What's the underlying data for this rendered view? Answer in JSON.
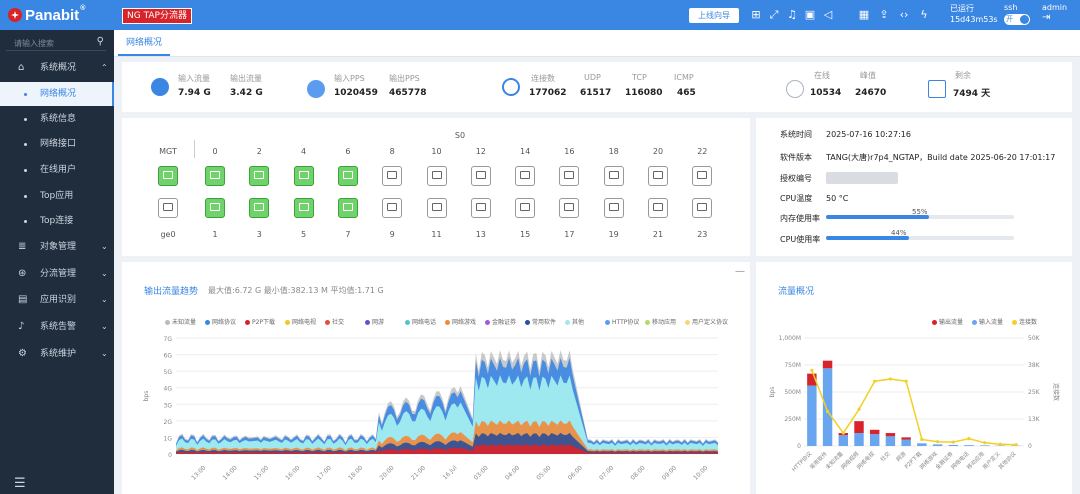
{
  "topbar": {
    "logo_text": "Panabit",
    "logo_reg": "®",
    "mode_badge": "NG TAP分流器",
    "guide_button": "上线向导",
    "uptime_label": "已运行",
    "uptime_value": "15d43m53s",
    "ssh_label": "ssh",
    "ssh_toggle": "开",
    "user_label": "admin",
    "brand_color": "#3a86e3",
    "badge_color": "#d8232a"
  },
  "sidebar": {
    "search_placeholder": "请输入搜索",
    "menu": [
      {
        "label": "系统概况",
        "icon": "home-icon"
      },
      {
        "label": "对象管理",
        "icon": "database-icon"
      },
      {
        "label": "分流管理",
        "icon": "flow-icon"
      },
      {
        "label": "应用识别",
        "icon": "app-icon"
      },
      {
        "label": "系统告警",
        "icon": "bell-icon"
      },
      {
        "label": "系统维护",
        "icon": "gear-icon"
      }
    ],
    "submenu": [
      {
        "label": "网络概况",
        "active": true
      },
      {
        "label": "系统信息"
      },
      {
        "label": "网络接口"
      },
      {
        "label": "在线用户"
      },
      {
        "label": "Top应用"
      },
      {
        "label": "Top连接"
      }
    ]
  },
  "tabs": [
    {
      "label": "网络概况"
    }
  ],
  "stats": {
    "in_traffic_label": "输入流量",
    "in_traffic": "7.94 G",
    "out_traffic_label": "输出流量",
    "out_traffic": "3.42 G",
    "in_pps_label": "输入PPS",
    "in_pps": "1020459",
    "out_pps_label": "输出PPS",
    "out_pps": "465778",
    "flows_label": "连接数",
    "flows": "177062",
    "udp_label": "UDP",
    "udp": "61517",
    "tcp_label": "TCP",
    "tcp": "116080",
    "icmp_label": "ICMP",
    "icmp": "465",
    "online_label": "在线",
    "online": "10534",
    "peak_label": "峰值",
    "peak": "24670",
    "license_label": "剩余",
    "license": "7494 天"
  },
  "ports": {
    "group_label": "S0",
    "mgt_label": "MGT",
    "mgt_port": "ge0",
    "top_numbers": [
      "0",
      "2",
      "4",
      "6",
      "8",
      "10",
      "12",
      "14",
      "16",
      "18",
      "20",
      "22"
    ],
    "bottom_numbers": [
      "1",
      "3",
      "5",
      "7",
      "9",
      "11",
      "13",
      "15",
      "17",
      "19",
      "21",
      "23"
    ],
    "top_up": [
      true,
      true,
      true,
      true,
      false,
      false,
      false,
      false,
      false,
      false,
      false,
      false
    ],
    "bottom_up": [
      true,
      true,
      true,
      true,
      false,
      false,
      false,
      false,
      false,
      false,
      false,
      false
    ],
    "mgt_top_up": true,
    "mgt_bottom_up": false
  },
  "sysinfo": {
    "time_label": "系统时间",
    "time_value": "2025-07-16 10:27:16",
    "version_label": "软件版本",
    "version_value": "TANG(大唐)r7p4_NGTAP，Build date 2025-06-20 17:01:17",
    "license_label": "授权编号",
    "cpu_temp_label": "CPU温度",
    "cpu_temp_value": "50 °C",
    "mem_label": "内存使用率",
    "mem_pct": 55,
    "mem_pct_text": "55%",
    "cpu_label": "CPU使用率",
    "cpu_pct": 44,
    "cpu_pct_text": "44%"
  },
  "trend": {
    "title": "输出流量趋势",
    "summary": "最大值:6.72 G  最小值:382.13 M  平均值:1.71 G",
    "legend": [
      "未知流量",
      "网络协议",
      "P2P下载",
      "网络电视",
      "社交",
      "网游",
      "网络电话",
      "网络游戏",
      "金融证券",
      "常用软件",
      "其他",
      "HTTP协议",
      "移动应用",
      "用户定义协议"
    ],
    "legend_colors": [
      "#bbbbbb",
      "#3a86e3",
      "#d8232a",
      "#f3c623",
      "#e0503a",
      "#6a4fc7",
      "#4fc7c7",
      "#f08a3a",
      "#a05bd8",
      "#2b4f9a",
      "#9ee8f0",
      "#5b9cf0",
      "#b8d86a",
      "#f5d67a"
    ],
    "ylabel": "bps",
    "yticks": [
      "0",
      "1G",
      "2G",
      "3G",
      "4G",
      "5G",
      "6G",
      "7G"
    ],
    "xticks": [
      "13:00",
      "14:00",
      "15:00",
      "16:00",
      "17:00",
      "18:00",
      "20:00",
      "21:00",
      "16 Jul",
      "03:00",
      "04:00",
      "05:00",
      "06:00",
      "07:00",
      "08:00",
      "09:00",
      "10:00"
    ]
  },
  "chart_data": {
    "type": "bar",
    "title": "流量概况",
    "legend": [
      "输出流量",
      "输入流量",
      "连接数"
    ],
    "ylabel": "bps",
    "y2label": "连接数",
    "yticks": [
      "0",
      "250M",
      "500M",
      "750M",
      "1,000M"
    ],
    "y2ticks": [
      "0",
      "13K",
      "25K",
      "38K",
      "50K"
    ],
    "ylim": [
      0,
      1000
    ],
    "y2lim": [
      0,
      50000
    ],
    "categories": [
      "HTTP协议",
      "常用软件",
      "未知流量",
      "网络视频",
      "网络电视",
      "社交",
      "网游",
      "P2P下载",
      "网络游戏",
      "金融证券",
      "网络电话",
      "移动应用",
      "用户定义",
      "其他协议"
    ],
    "series": [
      {
        "name": "输出流量",
        "color": "#d8232a",
        "values": [
          110,
          70,
          20,
          110,
          40,
          30,
          20,
          0,
          0,
          0,
          0,
          0,
          0,
          0
        ]
      },
      {
        "name": "输入流量",
        "color": "#6aa6f0",
        "values": [
          560,
          720,
          100,
          120,
          110,
          90,
          60,
          25,
          15,
          10,
          8,
          6,
          4,
          3
        ]
      },
      {
        "name": "连接数",
        "color": "#f3d023",
        "values": [
          35000,
          16000,
          6000,
          17000,
          30000,
          31000,
          30000,
          3000,
          2000,
          1800,
          3400,
          1500,
          800,
          600
        ]
      }
    ]
  }
}
